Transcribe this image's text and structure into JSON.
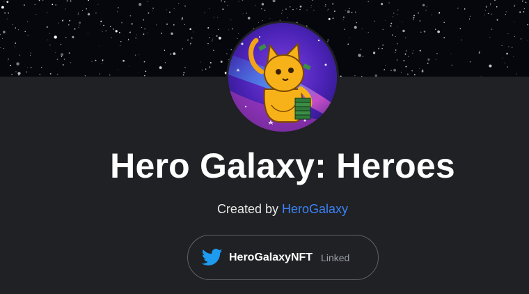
{
  "collection": {
    "title": "Hero Galaxy: Heroes",
    "created_by_prefix": "Created by",
    "creator_name": "HeroGalaxy",
    "avatar_icon": "cat-hero-avatar-icon",
    "banner": "starfield-banner"
  },
  "social": {
    "platform_icon": "twitter-icon",
    "handle": "HeroGalaxyNFT",
    "status": "Linked"
  },
  "colors": {
    "background": "#202124",
    "link": "#3b82f6",
    "twitter": "#1d9bf0",
    "muted": "#9aa0a6"
  }
}
